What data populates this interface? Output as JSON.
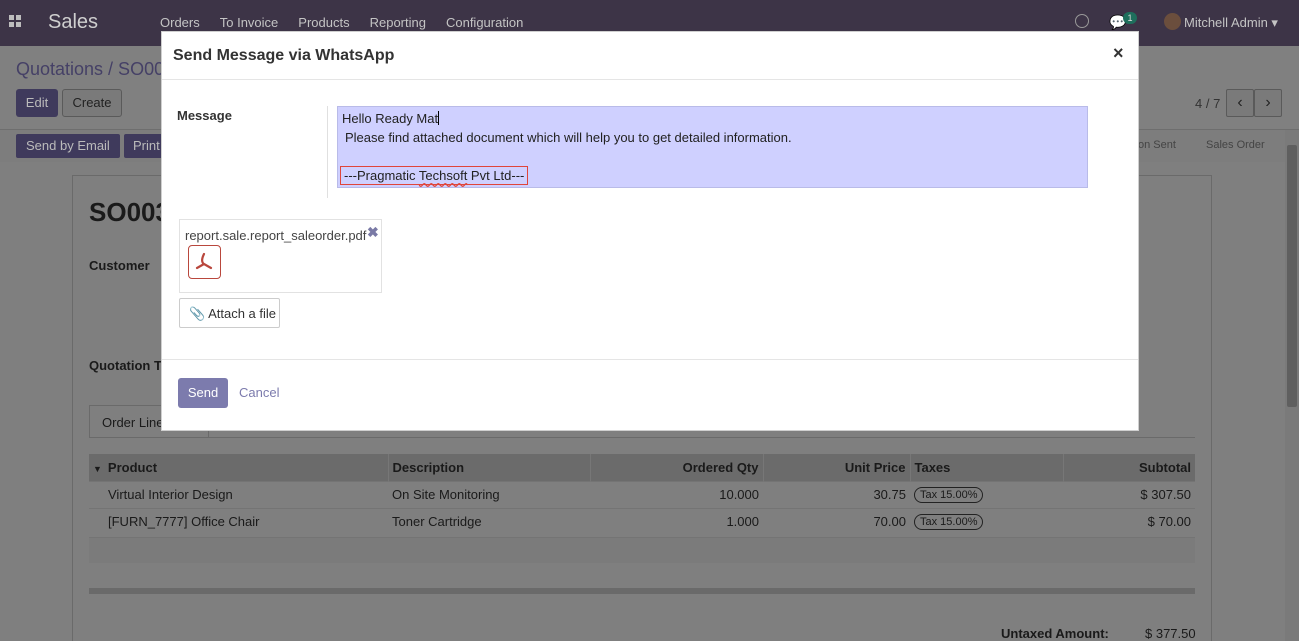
{
  "navbar": {
    "app_name": "Sales",
    "menu": [
      "Orders",
      "To Invoice",
      "Products",
      "Reporting",
      "Configuration"
    ],
    "chat_count": "1",
    "user": "Mitchell Admin"
  },
  "control": {
    "breadcrumb": "Quotations / SO00",
    "edit_label": "Edit",
    "create_label": "Create",
    "pager": "4 / 7"
  },
  "statusbar": {
    "send_email_label": "Send by Email",
    "print_label": "Print",
    "stage_sent": "on Sent",
    "stage_order": "Sales Order"
  },
  "form": {
    "name": "SO003",
    "customer_label": "Customer",
    "quotation_label": "Quotation T",
    "tab_label": "Order Lines",
    "columns": [
      "Product",
      "Description",
      "Ordered Qty",
      "Unit Price",
      "Taxes",
      "Subtotal"
    ],
    "rows": [
      {
        "product": "Virtual Interior Design",
        "description": "On Site Monitoring",
        "qty": "10.000",
        "price": "30.75",
        "tax": "Tax 15.00%",
        "subtotal": "$ 307.50"
      },
      {
        "product": "[FURN_7777] Office Chair",
        "description": "Toner Cartridge",
        "qty": "1.000",
        "price": "70.00",
        "tax": "Tax 15.00%",
        "subtotal": "$ 70.00"
      }
    ],
    "untaxed_label": "Untaxed Amount:",
    "untaxed_value": "$ 377.50"
  },
  "modal": {
    "title": "Send Message via WhatsApp",
    "close": "×",
    "message_label": "Message",
    "message_line1": "Hello Ready Mat",
    "message_line2": "Please find attached document which will help you to get detailed information.",
    "signature_prefix": "---Pragmatic ",
    "signature_word": "Techsoft",
    "signature_suffix": " Pvt Ltd---",
    "attachment_name": "report.sale.report_saleorder.pdf",
    "attach_label": "Attach a file",
    "send_label": "Send",
    "cancel_label": "Cancel"
  },
  "colors": {
    "accent": "#7c7bad",
    "message_highlight": "#cfd0ff",
    "signature_border": "#e0453a"
  }
}
